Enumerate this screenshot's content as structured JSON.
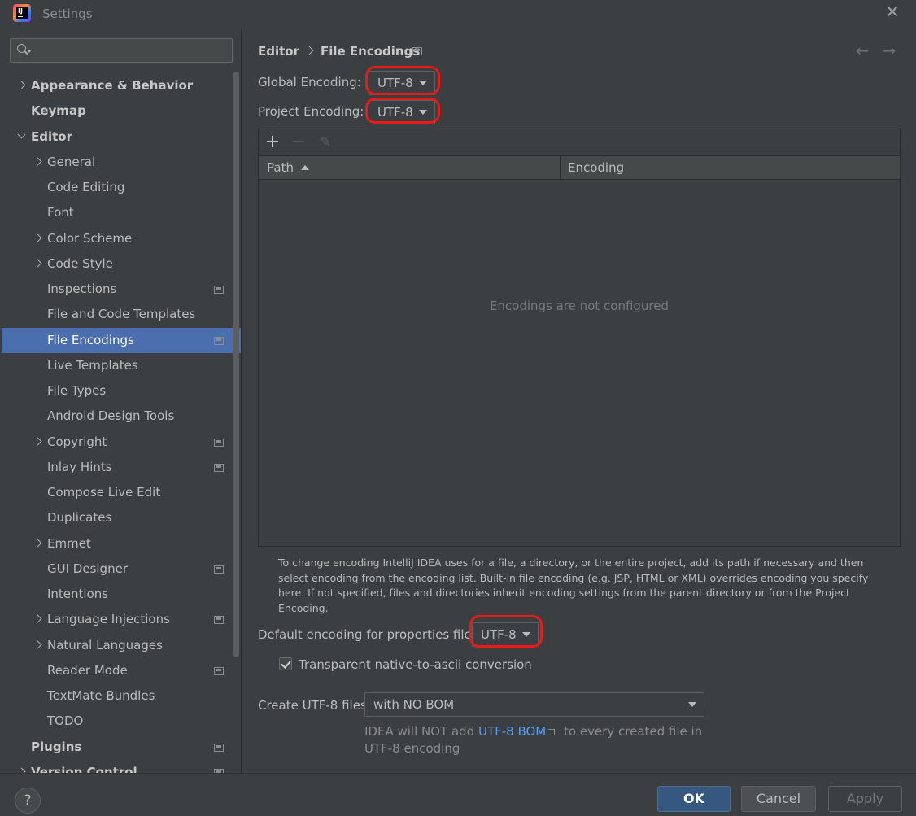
{
  "window": {
    "title": "Settings",
    "close_glyph": "✕"
  },
  "sidebar": {
    "search_placeholder": "",
    "items": [
      {
        "label": "Appearance & Behavior",
        "bold": true,
        "chevron": "right",
        "indent": 0,
        "proj": false
      },
      {
        "label": "Keymap",
        "bold": true,
        "chevron": "",
        "indent": 0,
        "proj": false
      },
      {
        "label": "Editor",
        "bold": true,
        "chevron": "down",
        "indent": 0,
        "proj": false
      },
      {
        "label": "General",
        "bold": false,
        "chevron": "right",
        "indent": 1,
        "proj": false
      },
      {
        "label": "Code Editing",
        "bold": false,
        "chevron": "",
        "indent": 1,
        "proj": false
      },
      {
        "label": "Font",
        "bold": false,
        "chevron": "",
        "indent": 1,
        "proj": false
      },
      {
        "label": "Color Scheme",
        "bold": false,
        "chevron": "right",
        "indent": 1,
        "proj": false
      },
      {
        "label": "Code Style",
        "bold": false,
        "chevron": "right",
        "indent": 1,
        "proj": false
      },
      {
        "label": "Inspections",
        "bold": false,
        "chevron": "",
        "indent": 1,
        "proj": true
      },
      {
        "label": "File and Code Templates",
        "bold": false,
        "chevron": "",
        "indent": 1,
        "proj": false
      },
      {
        "label": "File Encodings",
        "bold": false,
        "chevron": "",
        "indent": 1,
        "proj": true,
        "selected": true
      },
      {
        "label": "Live Templates",
        "bold": false,
        "chevron": "",
        "indent": 1,
        "proj": false
      },
      {
        "label": "File Types",
        "bold": false,
        "chevron": "",
        "indent": 1,
        "proj": false
      },
      {
        "label": "Android Design Tools",
        "bold": false,
        "chevron": "",
        "indent": 1,
        "proj": false
      },
      {
        "label": "Copyright",
        "bold": false,
        "chevron": "right",
        "indent": 1,
        "proj": true
      },
      {
        "label": "Inlay Hints",
        "bold": false,
        "chevron": "",
        "indent": 1,
        "proj": true
      },
      {
        "label": "Compose Live Edit",
        "bold": false,
        "chevron": "",
        "indent": 1,
        "proj": false
      },
      {
        "label": "Duplicates",
        "bold": false,
        "chevron": "",
        "indent": 1,
        "proj": false
      },
      {
        "label": "Emmet",
        "bold": false,
        "chevron": "right",
        "indent": 1,
        "proj": false
      },
      {
        "label": "GUI Designer",
        "bold": false,
        "chevron": "",
        "indent": 1,
        "proj": true
      },
      {
        "label": "Intentions",
        "bold": false,
        "chevron": "",
        "indent": 1,
        "proj": false
      },
      {
        "label": "Language Injections",
        "bold": false,
        "chevron": "right",
        "indent": 1,
        "proj": true
      },
      {
        "label": "Natural Languages",
        "bold": false,
        "chevron": "right",
        "indent": 1,
        "proj": false
      },
      {
        "label": "Reader Mode",
        "bold": false,
        "chevron": "",
        "indent": 1,
        "proj": true
      },
      {
        "label": "TextMate Bundles",
        "bold": false,
        "chevron": "",
        "indent": 1,
        "proj": false
      },
      {
        "label": "TODO",
        "bold": false,
        "chevron": "",
        "indent": 1,
        "proj": false
      },
      {
        "label": "Plugins",
        "bold": true,
        "chevron": "",
        "indent": 0,
        "proj": true
      },
      {
        "label": "Version Control",
        "bold": true,
        "chevron": "right",
        "indent": 0,
        "proj": true
      }
    ]
  },
  "main": {
    "breadcrumb": {
      "parent": "Editor",
      "current": "File Encodings"
    },
    "nav": {
      "back": "←",
      "forward": "→"
    },
    "global_encoding": {
      "label": "Global Encoding:",
      "value": "UTF-8"
    },
    "project_encoding": {
      "label": "Project Encoding:",
      "value": "UTF-8"
    },
    "table": {
      "toolbar": {
        "add": "+",
        "remove": "−",
        "edit": "✎"
      },
      "columns": [
        "Path",
        "Encoding"
      ],
      "empty_text": "Encodings are not configured"
    },
    "help_text": "To change encoding IntelliJ IDEA uses for a file, a directory, or the entire project, add its path if necessary and then select encoding from the encoding list. Built-in file encoding (e.g. JSP, HTML or XML) overrides encoding you specify here. If not specified, files and directories inherit encoding settings from the parent directory or from the Project Encoding.",
    "properties_encoding": {
      "label": "Default encoding for properties files:",
      "value": "UTF-8"
    },
    "native_to_ascii": {
      "label": "Transparent native-to-ascii conversion",
      "checked": true
    },
    "create_utf8": {
      "label": "Create UTF-8 files:",
      "value": "with NO BOM"
    },
    "bom_hint": {
      "before": "IDEA will NOT add ",
      "link": "UTF-8 BOM",
      "after": " to every created file in UTF-8 encoding"
    }
  },
  "footer": {
    "help": "?",
    "ok": "OK",
    "cancel": "Cancel",
    "apply": "Apply"
  },
  "colors": {
    "selection": "#4b6eaf",
    "annotation": "#e81a1a",
    "link": "#589df6",
    "ok_button": "#365880"
  }
}
